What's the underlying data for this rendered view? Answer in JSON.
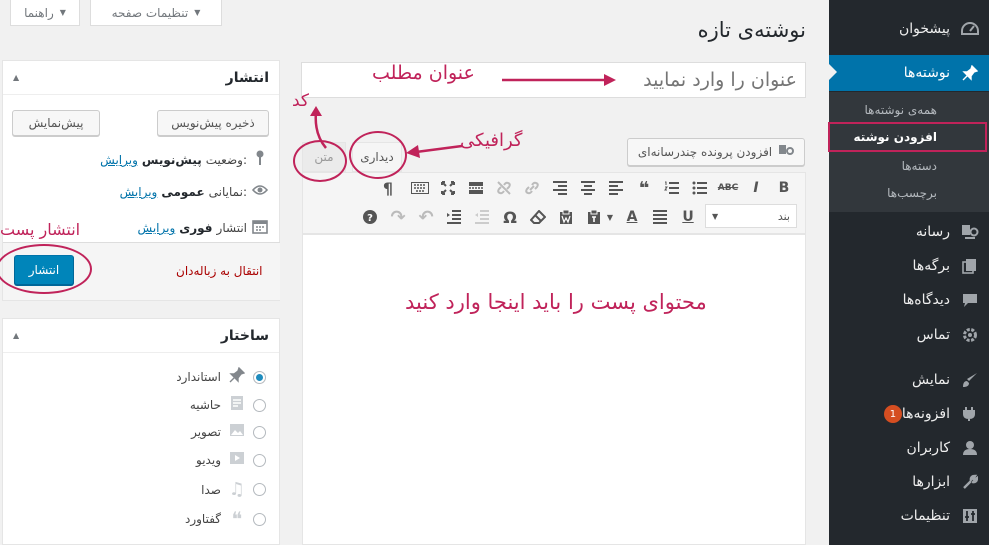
{
  "screen_options": {
    "help_label": "راهنما",
    "options_label": "تنظیمات صفحه"
  },
  "page": {
    "title": "نوشته‌ی تازه",
    "title_placeholder": "عنوان را وارد نمایید"
  },
  "sidebar": {
    "dashboard": "پیشخوان",
    "posts": "نوشته‌ها",
    "submenu": [
      "همه‌ی نوشته‌ها",
      "افزودن نوشته",
      "دسته‌ها",
      "برچسب‌ها"
    ],
    "media": "رسانه",
    "pages": "برگه‌ها",
    "comments": "دیدگاه‌ها",
    "contact": "تماس",
    "appearance": "نمایش",
    "plugins": "افزونه‌ها",
    "plugins_badge": "1",
    "users": "کاربران",
    "tools": "ابزارها",
    "settings": "تنظیمات"
  },
  "editor": {
    "add_media": "افزودن پرونده چندرسانه‌ای",
    "tab_visual": "دیداری",
    "tab_text": "متن",
    "format_select": "بند"
  },
  "publish_box": {
    "title": "انتشار",
    "save_draft": "ذخیره پیش‌نویس",
    "preview": "پیش‌نمایش",
    "status_label": "وضعیت:",
    "status_value": "پیش‌نویس",
    "visibility_label": "نمایانی:",
    "visibility_value": "عمومی",
    "schedule_label": "انتشار",
    "schedule_value": "فوری",
    "edit_link": "ویرایش",
    "trash": "انتقال به زباله‌دان",
    "publish": "انتشار"
  },
  "format_box": {
    "title": "ساختار",
    "options": [
      "استاندارد",
      "حاشیه",
      "تصویر",
      "ویدیو",
      "صدا",
      "گفتاورد"
    ]
  },
  "annotations": {
    "title_note": "عنوان مطلب",
    "code_note": "کد",
    "visual_note": "گرافیکی",
    "publish_note": "انتشار پست",
    "content_note": "محتوای پست را باید اینجا وارد کنید"
  },
  "colors": {
    "sidebar_bg": "#23282d",
    "active": "#0073aa",
    "annotation": "#c0235a",
    "publish_btn": "#0085ba"
  }
}
